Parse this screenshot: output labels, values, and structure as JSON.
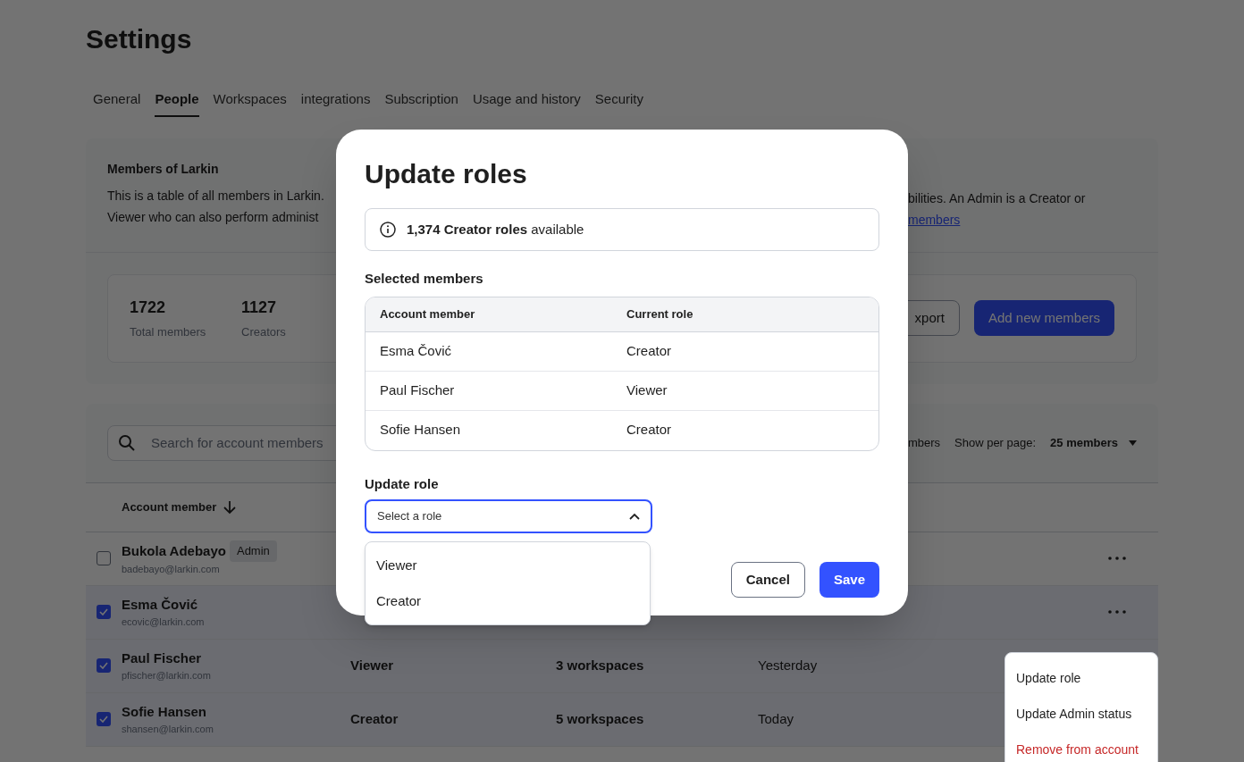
{
  "page_title": "Settings",
  "tabs": [
    {
      "label": "General",
      "selected": false
    },
    {
      "label": "People",
      "selected": true
    },
    {
      "label": "Workspaces",
      "selected": false
    },
    {
      "label": "integrations",
      "selected": false
    },
    {
      "label": "Subscription",
      "selected": false
    },
    {
      "label": "Usage and history",
      "selected": false
    },
    {
      "label": "Security",
      "selected": false
    }
  ],
  "members_card": {
    "title": "Members of Larkin",
    "description_left": [
      "This is a table of all members in Larkin.",
      "Viewer who can also perform administ"
    ],
    "description_right": "bilities. An Admin is a Creator or",
    "link": "members"
  },
  "stats": [
    {
      "value": "1722",
      "label": "Total members"
    },
    {
      "value": "1127",
      "label": "Creators"
    }
  ],
  "actions": [
    {
      "label": "xport",
      "kind": "outline"
    },
    {
      "label": "Add new members",
      "kind": "primary"
    }
  ],
  "search": {
    "placeholder": "Search for account members"
  },
  "pagination": {
    "count_fragment": "mbers",
    "per_page_label": "Show per page:",
    "per_page_value": "25 members"
  },
  "table": {
    "columns": [
      "Account member"
    ],
    "rows": [
      {
        "name": "Bukola Adebayo",
        "badge": "Admin",
        "email": "badebayo@larkin.com",
        "checked": false,
        "has_menu": true
      },
      {
        "name": "Esma Čović",
        "email": "ecovic@larkin.com",
        "checked": true,
        "has_menu": true
      },
      {
        "name": "Paul Fischer",
        "email": "pfischer@larkin.com",
        "checked": true,
        "role": "Viewer",
        "workspaces": "3 workspaces",
        "last_active": "Yesterday",
        "has_menu": false
      },
      {
        "name": "Sofie Hansen",
        "email": "shansen@larkin.com",
        "checked": true,
        "role": "Creator",
        "workspaces": "5 workspaces",
        "last_active": "Today",
        "has_menu": false
      }
    ]
  },
  "context_menu": {
    "items": [
      {
        "label": "Update role",
        "kind": "normal"
      },
      {
        "label": "Update Admin status",
        "kind": "normal"
      },
      {
        "label": "Remove from account",
        "kind": "danger"
      }
    ]
  },
  "modal": {
    "title": "Update roles",
    "info": "**1,374 Creator roles** available",
    "selected_label": "Selected members",
    "columns": [
      "Account member",
      "Current role"
    ],
    "rows": [
      [
        "Esma Čović",
        "Creator"
      ],
      [
        "Paul Fischer",
        "Viewer"
      ],
      [
        "Sofie Hansen",
        "Creator"
      ]
    ],
    "update_label": "Update role",
    "select": {
      "placeholder": "Select a role",
      "expanded": true,
      "options": [
        "Viewer",
        "Creator"
      ]
    },
    "buttons": [
      {
        "label": "Cancel",
        "kind": "secondary"
      },
      {
        "label": "Save",
        "kind": "primary"
      }
    ]
  }
}
